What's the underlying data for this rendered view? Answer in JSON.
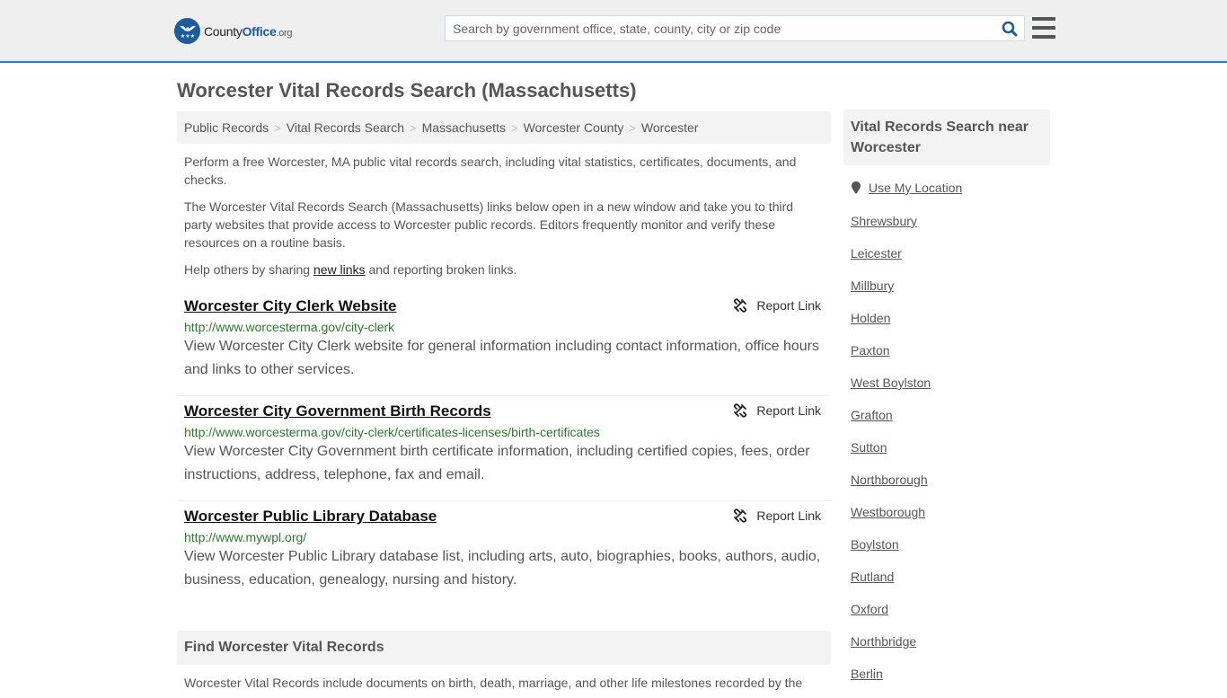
{
  "header": {
    "logo": {
      "name_part1": "County",
      "name_part2": "Office",
      "name_part3": ".org"
    },
    "search": {
      "placeholder": "Search by government office, state, county, city or zip code",
      "value": ""
    },
    "colors": {
      "brand": "#1c5c9c",
      "header_bg": "#efefef",
      "header_border": "#3a7cb0"
    }
  },
  "page": {
    "title": "Worcester Vital Records Search (Massachusetts)"
  },
  "breadcrumb": [
    {
      "label": "Public Records"
    },
    {
      "label": "Vital Records Search"
    },
    {
      "label": "Massachusetts"
    },
    {
      "label": "Worcester County"
    },
    {
      "label": "Worcester"
    }
  ],
  "intro": {
    "p1": "Perform a free Worcester, MA public vital records search, including vital statistics, certificates, documents, and checks.",
    "p2": "The Worcester Vital Records Search (Massachusetts) links below open in a new window and take you to third party websites that provide access to Worcester public records. Editors frequently monitor and verify these resources on a routine basis.",
    "p3_before": "Help others by sharing ",
    "p3_link": "new links",
    "p3_after": " and reporting broken links."
  },
  "results": [
    {
      "title": "Worcester City Clerk Website",
      "url": "http://www.worcesterma.gov/city-clerk",
      "description": "View Worcester City Clerk website for general information including contact information, office hours and links to other services.",
      "report_label": "Report Link"
    },
    {
      "title": "Worcester City Government Birth Records",
      "url": "http://www.worcesterma.gov/city-clerk/certificates-licenses/birth-certificates",
      "description": "View Worcester City Government birth certificate information, including certified copies, fees, order instructions, address, telephone, fax and email.",
      "report_label": "Report Link"
    },
    {
      "title": "Worcester Public Library Database",
      "url": "http://www.mywpl.org/",
      "description": "View Worcester Public Library database list, including arts, auto, biographies, books, authors, audio, business, education, genealogy, nursing and history.",
      "report_label": "Report Link"
    }
  ],
  "find_section": {
    "heading": "Find Worcester Vital Records",
    "text": "Worcester Vital Records include documents on birth, death, marriage, and other life milestones recorded by the"
  },
  "sidebar": {
    "heading": "Vital Records Search near Worcester",
    "use_location": "Use My Location",
    "places": [
      "Shrewsbury",
      "Leicester",
      "Millbury",
      "Holden",
      "Paxton",
      "West Boylston",
      "Grafton",
      "Sutton",
      "Northborough",
      "Westborough",
      "Boylston",
      "Rutland",
      "Oxford",
      "Northbridge",
      "Berlin"
    ]
  }
}
